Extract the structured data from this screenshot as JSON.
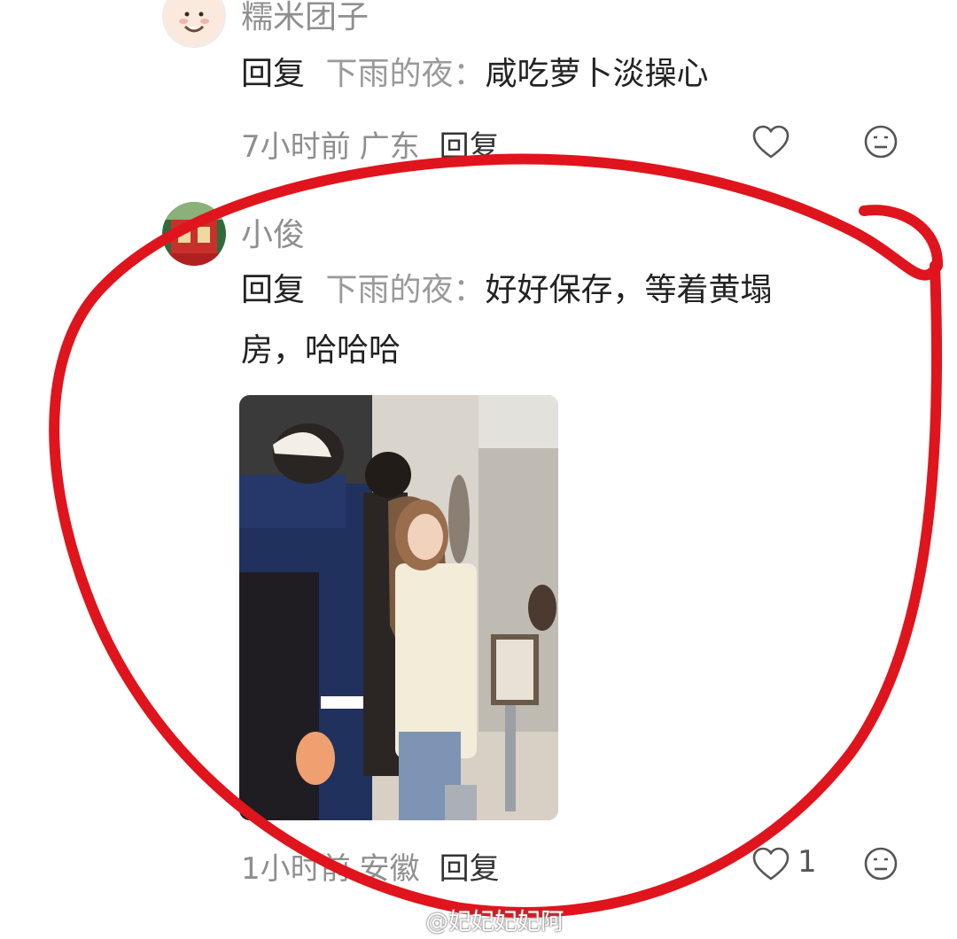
{
  "comments": [
    {
      "username": "糯米团子",
      "reply_prefix": "回复",
      "reply_target": "下雨的夜：",
      "text": "咸吃萝卜淡操心",
      "time": "7小时前",
      "location": "广东",
      "reply_label": "回复",
      "likes": ""
    },
    {
      "username": "小俊",
      "reply_prefix": "回复",
      "reply_target": "下雨的夜：",
      "text_line1": "好好保存，等着黄塌",
      "text_line2": "房，哈哈哈",
      "time": "1小时前",
      "location": "安徽",
      "reply_label": "回复",
      "likes": "1"
    }
  ],
  "watermark": "@妃妃妃妃阿",
  "colors": {
    "annotation_circle": "#e0141c",
    "muted_text": "#8f8f8f"
  },
  "icons": [
    "heart-icon",
    "meh-face-icon",
    "weibo-logo-icon"
  ]
}
